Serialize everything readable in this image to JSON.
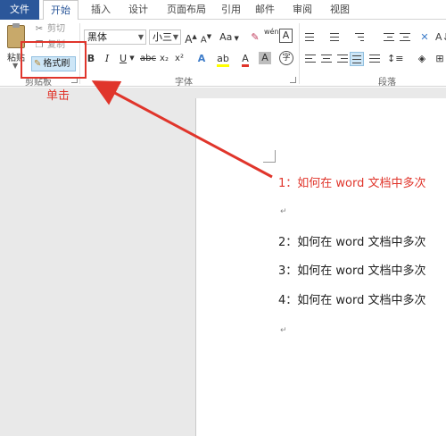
{
  "tabs": [
    "文件",
    "开始",
    "插入",
    "设计",
    "页面布局",
    "引用",
    "邮件",
    "审阅",
    "视图"
  ],
  "clipboard": {
    "paste_label": "粘贴",
    "cut_label": "剪切",
    "copy_label": "复制",
    "format_painter_label": "格式刷",
    "group_label": "剪贴板"
  },
  "font": {
    "font_name": "黑体",
    "font_size": "小三",
    "grow_label": "A",
    "shrink_label": "A",
    "case_label": "Aa",
    "phonetic_label": "wén",
    "bold_label": "B",
    "italic_label": "I",
    "underline_label": "U",
    "strike_label": "abc",
    "sub_label": "x₂",
    "sup_label": "x²",
    "group_label": "字体"
  },
  "paragraph": {
    "group_label": "段落"
  },
  "annotation": {
    "click_label": "单击",
    "color": "#e0352b"
  },
  "document": {
    "lines": [
      {
        "text": "1：如何在 word 文档中多次",
        "color": "#e0352b"
      },
      {
        "text": "2：如何在 word 文档中多次",
        "color": "#222222"
      },
      {
        "text": "3：如何在 word 文档中多次",
        "color": "#222222"
      },
      {
        "text": "4：如何在 word 文档中多次",
        "color": "#222222"
      }
    ],
    "paragraph_mark": "↵"
  },
  "colors": {
    "file_tab": "#2b579a",
    "highlight": "#cde6f7"
  }
}
